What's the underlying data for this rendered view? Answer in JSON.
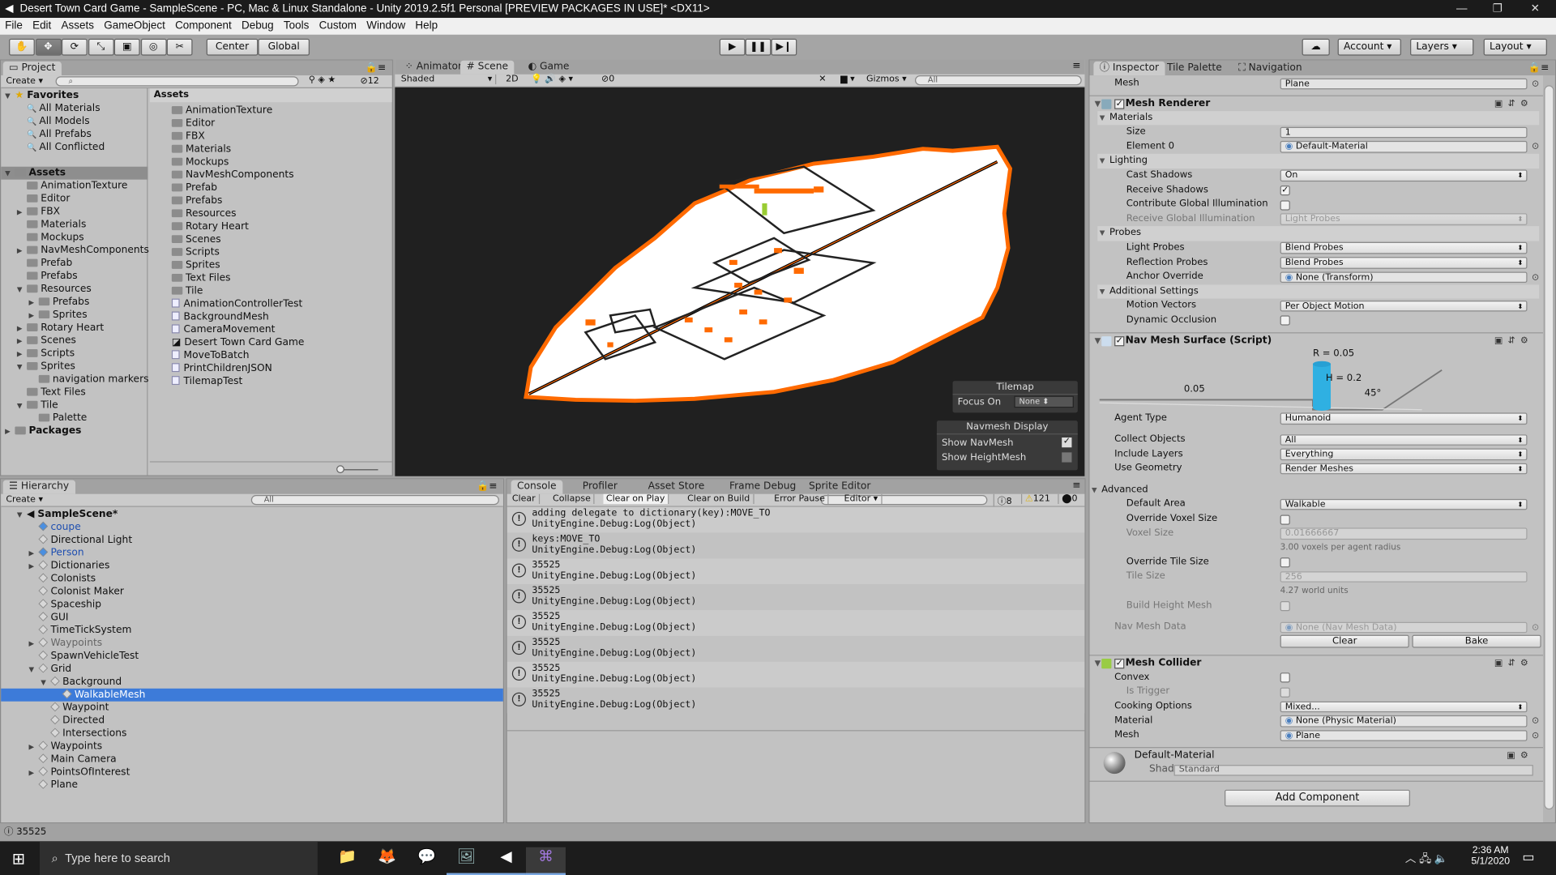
{
  "window": {
    "title": "Desert Town Card Game - SampleScene - PC, Mac & Linux Standalone - Unity 2019.2.5f1 Personal [PREVIEW PACKAGES IN USE]* <DX11>"
  },
  "menu": [
    "File",
    "Edit",
    "Assets",
    "GameObject",
    "Component",
    "Debug",
    "Tools",
    "Custom",
    "Window",
    "Help"
  ],
  "toolbar": {
    "tools": [
      "hand-icon",
      "move-icon",
      "rotate-icon",
      "scale-icon",
      "rect-icon",
      "transform-icon",
      "custom-tool-icon"
    ],
    "active_tool": 1,
    "pivot": "Center",
    "space": "Global",
    "account": "Account",
    "layers": "Layers",
    "layout": "Layout"
  },
  "project": {
    "tab": "Project",
    "create": "Create",
    "search_placeholder": "",
    "hidden_count": "12",
    "assets_header": "Assets",
    "tree": [
      {
        "label": "Favorites",
        "depth": 0,
        "arrow": "open",
        "icon": "star",
        "bold": true
      },
      {
        "label": "All Materials",
        "depth": 1,
        "icon": "search"
      },
      {
        "label": "All Models",
        "depth": 1,
        "icon": "search"
      },
      {
        "label": "All Prefabs",
        "depth": 1,
        "icon": "search"
      },
      {
        "label": "All Conflicted",
        "depth": 1,
        "icon": "search"
      },
      {
        "label": "",
        "depth": 0,
        "icon": "none"
      },
      {
        "label": "Assets",
        "depth": 0,
        "arrow": "open",
        "icon": "folder",
        "bold": true,
        "selected": true
      },
      {
        "label": "AnimationTexture",
        "depth": 1,
        "icon": "folder"
      },
      {
        "label": "Editor",
        "depth": 1,
        "icon": "folder"
      },
      {
        "label": "FBX",
        "depth": 1,
        "arrow": "closed",
        "icon": "folder"
      },
      {
        "label": "Materials",
        "depth": 1,
        "icon": "folder"
      },
      {
        "label": "Mockups",
        "depth": 1,
        "icon": "folder"
      },
      {
        "label": "NavMeshComponents",
        "depth": 1,
        "arrow": "closed",
        "icon": "folder"
      },
      {
        "label": "Prefab",
        "depth": 1,
        "icon": "folder"
      },
      {
        "label": "Prefabs",
        "depth": 1,
        "icon": "folder"
      },
      {
        "label": "Resources",
        "depth": 1,
        "arrow": "open",
        "icon": "folder"
      },
      {
        "label": "Prefabs",
        "depth": 2,
        "arrow": "closed",
        "icon": "folder"
      },
      {
        "label": "Sprites",
        "depth": 2,
        "arrow": "closed",
        "icon": "folder"
      },
      {
        "label": "Rotary Heart",
        "depth": 1,
        "arrow": "closed",
        "icon": "folder"
      },
      {
        "label": "Scenes",
        "depth": 1,
        "arrow": "closed",
        "icon": "folder"
      },
      {
        "label": "Scripts",
        "depth": 1,
        "arrow": "closed",
        "icon": "folder"
      },
      {
        "label": "Sprites",
        "depth": 1,
        "arrow": "open",
        "icon": "folder"
      },
      {
        "label": "navigation markers",
        "depth": 2,
        "icon": "folder"
      },
      {
        "label": "Text Files",
        "depth": 1,
        "icon": "folder"
      },
      {
        "label": "Tile",
        "depth": 1,
        "arrow": "open",
        "icon": "folder"
      },
      {
        "label": "Palette",
        "depth": 2,
        "icon": "folder"
      },
      {
        "label": "Packages",
        "depth": 0,
        "arrow": "closed",
        "icon": "folder",
        "bold": true
      }
    ],
    "assets": [
      {
        "label": "AnimationTexture",
        "icon": "folder"
      },
      {
        "label": "Editor",
        "icon": "folder"
      },
      {
        "label": "FBX",
        "icon": "folder"
      },
      {
        "label": "Materials",
        "icon": "folder"
      },
      {
        "label": "Mockups",
        "icon": "folder"
      },
      {
        "label": "NavMeshComponents",
        "icon": "folder"
      },
      {
        "label": "Prefab",
        "icon": "folder"
      },
      {
        "label": "Prefabs",
        "icon": "folder"
      },
      {
        "label": "Resources",
        "icon": "folder"
      },
      {
        "label": "Rotary Heart",
        "icon": "folder"
      },
      {
        "label": "Scenes",
        "icon": "folder"
      },
      {
        "label": "Scripts",
        "icon": "folder"
      },
      {
        "label": "Sprites",
        "icon": "folder"
      },
      {
        "label": "Text Files",
        "icon": "folder"
      },
      {
        "label": "Tile",
        "icon": "folder"
      },
      {
        "label": "AnimationControllerTest",
        "icon": "script"
      },
      {
        "label": "BackgroundMesh",
        "icon": "script"
      },
      {
        "label": "CameraMovement",
        "icon": "script"
      },
      {
        "label": "Desert Town Card Game",
        "icon": "unity"
      },
      {
        "label": "MoveToBatch",
        "icon": "script"
      },
      {
        "label": "PrintChildrenJSON",
        "icon": "script"
      },
      {
        "label": "TilemapTest",
        "icon": "script"
      }
    ]
  },
  "scene": {
    "tabs": [
      "Animator",
      "Scene",
      "Game"
    ],
    "active_tab": 1,
    "shading": "Shaded",
    "mode_2d": "2D",
    "hidden_count": "0",
    "gizmos": "Gizmos",
    "search_placeholder": "All",
    "tilemap": {
      "title": "Tilemap",
      "focus_label": "Focus On",
      "focus_value": "None"
    },
    "navmesh": {
      "title": "Navmesh Display",
      "show_navmesh": "Show NavMesh",
      "show_navmesh_checked": true,
      "show_heightmesh": "Show HeightMesh",
      "show_heightmesh_checked": false
    },
    "colors": {
      "background": "#202020",
      "navmesh": "#ffffff",
      "edge": "#ff6a00"
    }
  },
  "hierarchy": {
    "tab": "Hierarchy",
    "create": "Create",
    "search_placeholder": "All",
    "items": [
      {
        "label": "SampleScene*",
        "depth": 0,
        "arrow": "open",
        "bold": true,
        "icon": "scene"
      },
      {
        "label": "coupe",
        "depth": 1,
        "icon": "prefab",
        "color": "#1f4fb0"
      },
      {
        "label": "Directional Light",
        "depth": 1
      },
      {
        "label": "Person",
        "depth": 1,
        "arrow": "closed",
        "icon": "prefab",
        "color": "#1f4fb0"
      },
      {
        "label": "Dictionaries",
        "depth": 1,
        "arrow": "closed"
      },
      {
        "label": "Colonists",
        "depth": 1
      },
      {
        "label": "Colonist Maker",
        "depth": 1
      },
      {
        "label": "Spaceship",
        "depth": 1
      },
      {
        "label": "GUI",
        "depth": 1
      },
      {
        "label": "TimeTickSystem",
        "depth": 1
      },
      {
        "label": "Waypoints",
        "depth": 1,
        "arrow": "closed",
        "color": "#666666"
      },
      {
        "label": "SpawnVehicleTest",
        "depth": 1
      },
      {
        "label": "Grid",
        "depth": 1,
        "arrow": "open"
      },
      {
        "label": "Background",
        "depth": 2,
        "arrow": "open"
      },
      {
        "label": "WalkableMesh",
        "depth": 3,
        "selected": true
      },
      {
        "label": "Waypoint",
        "depth": 2
      },
      {
        "label": "Directed",
        "depth": 2
      },
      {
        "label": "Intersections",
        "depth": 2
      },
      {
        "label": "Waypoints",
        "depth": 1,
        "arrow": "closed"
      },
      {
        "label": "Main Camera",
        "depth": 1
      },
      {
        "label": "PointsOfInterest",
        "depth": 1,
        "arrow": "closed"
      },
      {
        "label": "Plane",
        "depth": 1
      }
    ]
  },
  "console": {
    "tabs": [
      "Console",
      "Profiler",
      "Asset Store",
      "Frame Debug",
      "Sprite Editor"
    ],
    "active_tab": 0,
    "buttons": [
      "Clear",
      "Collapse",
      "Clear on Play",
      "Clear on Build",
      "Error Pause",
      "Editor"
    ],
    "active_buttons": [
      2
    ],
    "log_count": "8",
    "warning_count": "121",
    "error_count": "0",
    "entries": [
      {
        "message": "adding delegate to dictionary(key):MOVE_TO",
        "trace": "UnityEngine.Debug:Log(Object)"
      },
      {
        "message": "keys:MOVE_TO",
        "trace": "UnityEngine.Debug:Log(Object)"
      },
      {
        "message": "35525",
        "trace": "UnityEngine.Debug:Log(Object)"
      },
      {
        "message": "35525",
        "trace": "UnityEngine.Debug:Log(Object)"
      },
      {
        "message": "35525",
        "trace": "UnityEngine.Debug:Log(Object)"
      },
      {
        "message": "35525",
        "trace": "UnityEngine.Debug:Log(Object)"
      },
      {
        "message": "35525",
        "trace": "UnityEngine.Debug:Log(Object)"
      },
      {
        "message": "35525",
        "trace": "UnityEngine.Debug:Log(Object)"
      }
    ]
  },
  "inspector": {
    "tabs": [
      "Inspector",
      "Tile Palette",
      "Navigation"
    ],
    "active_tab": 0,
    "partial_row": {
      "label": "Mesh",
      "value": "Plane"
    },
    "mesh_renderer": {
      "title": "Mesh Renderer",
      "enabled": true,
      "rows": [
        {
          "type": "sub",
          "label": "Materials"
        },
        {
          "type": "field",
          "label": "Size",
          "value": "1",
          "l2": true
        },
        {
          "type": "obj",
          "label": "Element 0",
          "value": "Default-Material",
          "l2": true
        },
        {
          "type": "sub",
          "label": "Lighting"
        },
        {
          "type": "dd",
          "label": "Cast Shadows",
          "value": "On",
          "l2": true
        },
        {
          "type": "chk",
          "label": "Receive Shadows",
          "checked": true,
          "l2": true
        },
        {
          "type": "chk",
          "label": "Contribute Global Illumination",
          "checked": false,
          "l2": true
        },
        {
          "type": "dd",
          "label": "Receive Global Illumination",
          "value": "Light Probes",
          "l2": true,
          "disabled": true
        },
        {
          "type": "sub",
          "label": "Probes"
        },
        {
          "type": "dd",
          "label": "Light Probes",
          "value": "Blend Probes",
          "l2": true
        },
        {
          "type": "dd",
          "label": "Reflection Probes",
          "value": "Blend Probes",
          "l2": true
        },
        {
          "type": "obj",
          "label": "Anchor Override",
          "value": "None (Transform)",
          "l2": true
        },
        {
          "type": "sub",
          "label": "Additional Settings"
        },
        {
          "type": "dd",
          "label": "Motion Vectors",
          "value": "Per Object Motion",
          "l2": true
        },
        {
          "type": "chk",
          "label": "Dynamic Occlusion",
          "checked": false,
          "l2": true
        }
      ]
    },
    "nav_mesh_surface": {
      "title": "Nav Mesh Surface (Script)",
      "enabled": true,
      "diagram": {
        "radius": "R = 0.05",
        "height": "H = 0.2",
        "step": "0.05",
        "slope": "45°"
      },
      "rows": [
        {
          "type": "dd",
          "label": "Agent Type",
          "value": "Humanoid"
        },
        {
          "type": "gap"
        },
        {
          "type": "dd",
          "label": "Collect Objects",
          "value": "All"
        },
        {
          "type": "dd",
          "label": "Include Layers",
          "value": "Everything"
        },
        {
          "type": "dd",
          "label": "Use Geometry",
          "value": "Render Meshes"
        },
        {
          "type": "gap"
        },
        {
          "type": "fold",
          "label": "Advanced"
        },
        {
          "type": "dd",
          "label": "Default Area",
          "value": "Walkable",
          "l2": true
        },
        {
          "type": "chk",
          "label": "Override Voxel Size",
          "checked": false,
          "l2": true
        },
        {
          "type": "field",
          "label": "Voxel Size",
          "value": "0.01666667",
          "l3": true,
          "disabled": true
        },
        {
          "type": "note",
          "label": "3.00 voxels per agent radius"
        },
        {
          "type": "chk",
          "label": "Override Tile Size",
          "checked": false,
          "l2": true
        },
        {
          "type": "field",
          "label": "Tile Size",
          "value": "256",
          "l3": true,
          "disabled": true
        },
        {
          "type": "note",
          "label": "4.27 world units"
        },
        {
          "type": "chk",
          "label": "Build Height Mesh",
          "checked": false,
          "l2": true,
          "disabled": true
        },
        {
          "type": "gap"
        },
        {
          "type": "obj",
          "label": "Nav Mesh Data",
          "value": "None (Nav Mesh Data)",
          "disabled": true
        }
      ],
      "clear_label": "Clear",
      "bake_label": "Bake"
    },
    "mesh_collider": {
      "title": "Mesh Collider",
      "enabled": true,
      "rows": [
        {
          "type": "chk",
          "label": "Convex",
          "checked": false
        },
        {
          "type": "chk",
          "label": "Is Trigger",
          "checked": false,
          "l2": true,
          "disabled": true
        },
        {
          "type": "dd",
          "label": "Cooking Options",
          "value": "Mixed..."
        },
        {
          "type": "obj",
          "label": "Material",
          "value": "None (Physic Material)"
        },
        {
          "type": "obj",
          "label": "Mesh",
          "value": "Plane"
        }
      ]
    },
    "material": {
      "name": "Default-Material",
      "shader_label": "Shader",
      "shader": "Standard"
    },
    "add_component": "Add Component"
  },
  "status_bar": {
    "message": "35525"
  },
  "taskbar": {
    "search_placeholder": "Type here to search",
    "time": "2:36 AM",
    "date": "5/1/2020",
    "apps": [
      "file-explorer-icon",
      "firefox-icon",
      "discord-icon",
      "app-icon",
      "unity-icon",
      "visual-studio-icon"
    ]
  }
}
